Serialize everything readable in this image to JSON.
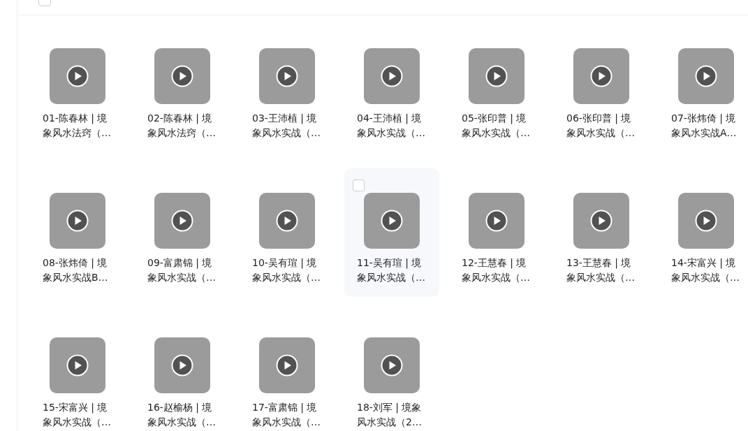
{
  "select_all": {
    "checked": false
  },
  "files": [
    {
      "title": "01-陈春林 | 境象风水法窍（…",
      "hovered": false
    },
    {
      "title": "02-陈春林 | 境象风水法窍（…",
      "hovered": false
    },
    {
      "title": "03-王沛植 | 境象风水实战（…",
      "hovered": false
    },
    {
      "title": "04-王沛植 | 境象风水实战（…",
      "hovered": false
    },
    {
      "title": "05-张印普 | 境象风水实战（…",
      "hovered": false
    },
    {
      "title": "06-张印普 | 境象风水实战（…",
      "hovered": false
    },
    {
      "title": "07-张炜倚 | 境象风水实战A…",
      "hovered": false
    },
    {
      "title": "08-张炜倚 | 境象风水实战B…",
      "hovered": false
    },
    {
      "title": "09-富肃锦 | 境象风水实战（…",
      "hovered": false
    },
    {
      "title": "10-吴有瑄 | 境象风水实战（…",
      "hovered": false
    },
    {
      "title": "11-吴有瑄 | 境象风水实战（…",
      "hovered": true
    },
    {
      "title": "12-王慧春 | 境象风水实战（…",
      "hovered": false
    },
    {
      "title": "13-王慧春 | 境象风水实战（…",
      "hovered": false
    },
    {
      "title": "14-宋富兴 | 境象风水实战（…",
      "hovered": false
    },
    {
      "title": "15-宋富兴 | 境象风水实战（…",
      "hovered": false
    },
    {
      "title": "16-赵榆杨 | 境象风水实战（…",
      "hovered": false
    },
    {
      "title": "17-富肃锦 | 境象风水实战（…",
      "hovered": false
    },
    {
      "title": "18-刘军 | 境象风水实战（2…",
      "hovered": false
    }
  ]
}
